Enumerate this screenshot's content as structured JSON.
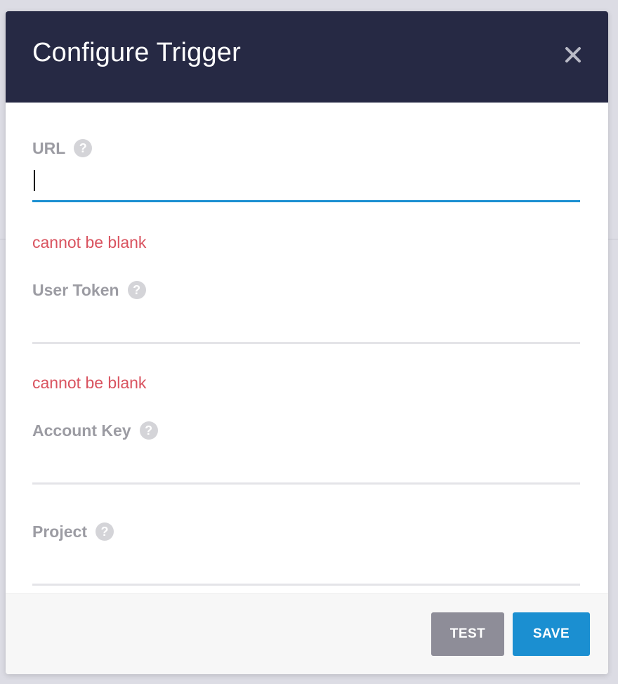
{
  "dialog": {
    "title": "Configure Trigger",
    "close_icon": "close-icon"
  },
  "fields": [
    {
      "label": "URL",
      "value": "",
      "focused": true,
      "error": "cannot be blank"
    },
    {
      "label": "User Token",
      "value": "",
      "focused": false,
      "error": "cannot be blank"
    },
    {
      "label": "Account Key",
      "value": "",
      "focused": false,
      "error": ""
    },
    {
      "label": "Project",
      "value": "",
      "focused": false,
      "error": ""
    }
  ],
  "help_icon_glyph": "?",
  "footer": {
    "test_label": "TEST",
    "save_label": "SAVE"
  },
  "colors": {
    "header_bg": "#262944",
    "accent": "#1b8fd1",
    "error": "#d9535f",
    "test_button": "#8e8d98"
  }
}
